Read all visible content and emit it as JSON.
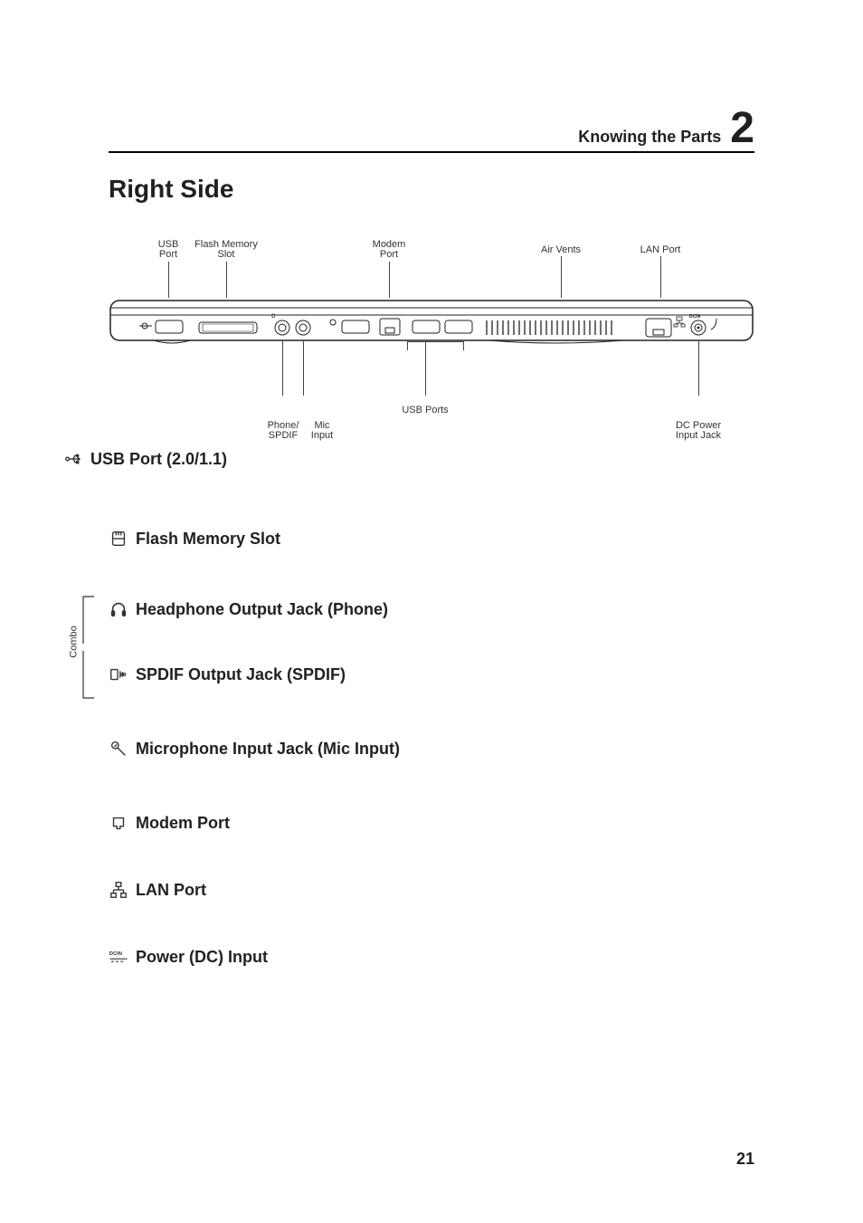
{
  "header": {
    "breadcrumb": "Knowing the Parts",
    "chapter": "2"
  },
  "title": "Right Side",
  "diagram": {
    "top_labels": [
      {
        "line1": "USB",
        "line2": "Port"
      },
      {
        "line1": "Flash Memory",
        "line2": "Slot"
      },
      {
        "line1": "Modem",
        "line2": "Port"
      },
      {
        "line1": "Air Vents",
        "line2": ""
      },
      {
        "line1": "LAN Port",
        "line2": ""
      }
    ],
    "bottom_labels": [
      {
        "line1": "Phone/",
        "line2": "SPDIF"
      },
      {
        "line1": "Mic",
        "line2": "Input"
      },
      {
        "line1": "USB Ports",
        "line2": ""
      },
      {
        "line1": "DC Power",
        "line2": "Input Jack"
      }
    ]
  },
  "combo_label": "Combo",
  "items": [
    {
      "label": "USB Port (2.0/1.1)",
      "icon": "usb-icon"
    },
    {
      "label": "Flash Memory Slot",
      "icon": "memory-slot-icon"
    },
    {
      "label": "Headphone Output Jack (Phone)",
      "icon": "headphone-icon"
    },
    {
      "label": "SPDIF Output Jack (SPDIF)",
      "icon": "spdif-icon"
    },
    {
      "label": "Microphone Input Jack (Mic Input)",
      "icon": "mic-icon"
    },
    {
      "label": "Modem Port",
      "icon": "modem-icon"
    },
    {
      "label": "LAN Port",
      "icon": "lan-icon"
    },
    {
      "label": "Power (DC) Input",
      "icon": "dcin-icon"
    }
  ],
  "page_number": "21"
}
